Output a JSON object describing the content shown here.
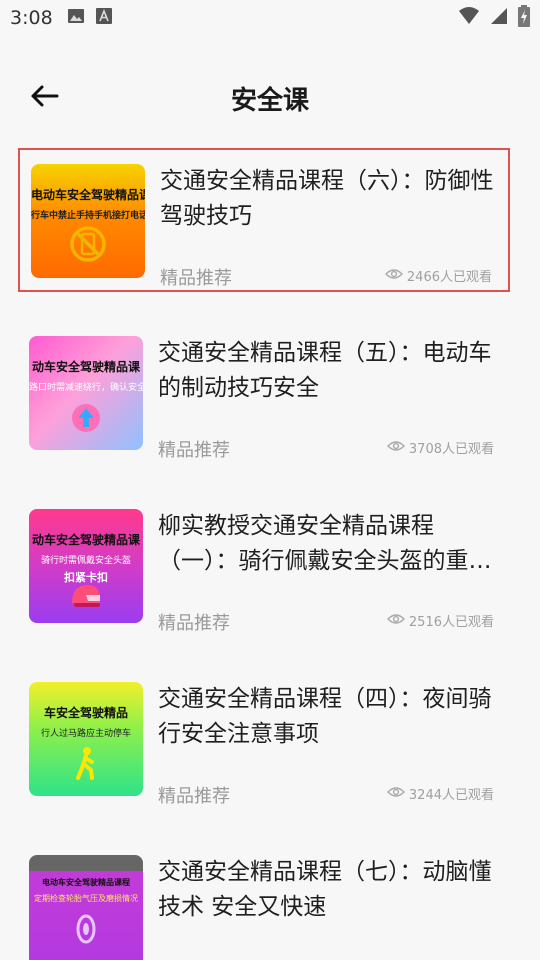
{
  "status_bar": {
    "time": "3:08"
  },
  "header": {
    "title": "安全课"
  },
  "courses": [
    {
      "title": "交通安全精品课程（六）：防御性驾驶技巧",
      "tag": "精品推荐",
      "views": "2466人已观看",
      "thumb": {
        "line1": "电动车安全驾驶精品课程",
        "line2": "行车中禁止手持手机接打电话",
        "line3": ""
      }
    },
    {
      "title": "交通安全精品课程（五）：电动车的制动技巧安全",
      "tag": "精品推荐",
      "views": "3708人已观看",
      "thumb": {
        "line1": "动车安全驾驶精品课",
        "line2": "路口时需减速绕行，确认安全",
        "line3": ""
      }
    },
    {
      "title": "柳实教授交通安全精品课程（一）：骑行佩戴安全头盔的重…",
      "tag": "精品推荐",
      "views": "2516人已观看",
      "thumb": {
        "line1": "动车安全驾驶精品课",
        "line2": "骑行时需佩戴安全头盔",
        "line3": "扣紧卡扣"
      }
    },
    {
      "title": "交通安全精品课程（四）：夜间骑行安全注意事项",
      "tag": "精品推荐",
      "views": "3244人已观看",
      "thumb": {
        "line1": "车安全驾驶精品",
        "line2": "行人过马路应主动停车",
        "line3": ""
      }
    },
    {
      "title": "交通安全精品课程（七）：动脑懂技术 安全又快速",
      "tag": "",
      "views": "",
      "thumb": {
        "line1": "电动车安全驾驶精品课程",
        "line2": "定期检查轮胎气压及磨损情况",
        "line3": ""
      }
    }
  ],
  "colors": {
    "selected_border": "#e05252",
    "tag_text": "#9a9a9a",
    "accent_icon": "#e8a400"
  }
}
